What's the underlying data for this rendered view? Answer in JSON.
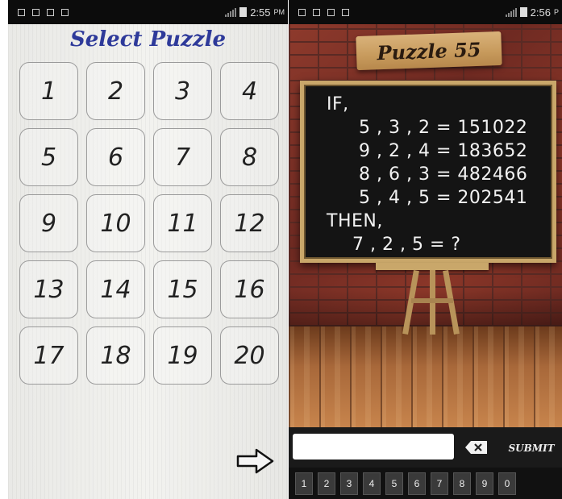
{
  "left_screen": {
    "status": {
      "time": "2:55",
      "ampm": "PM"
    },
    "title": "Select Puzzle",
    "puzzles": [
      "1",
      "2",
      "3",
      "4",
      "5",
      "6",
      "7",
      "8",
      "9",
      "10",
      "11",
      "12",
      "13",
      "14",
      "15",
      "16",
      "17",
      "18",
      "19",
      "20"
    ],
    "next_icon": "arrow-right-icon"
  },
  "right_screen": {
    "status": {
      "time": "2:56",
      "ampm": "P"
    },
    "puzzle_title": "Puzzle 55",
    "board_lines": [
      "IF,",
      "5 , 3 , 2 = 151022",
      "9 , 2 , 4 = 183652",
      "8 , 6 , 3 = 482466",
      "5 , 4 , 5 = 202541",
      "THEN,",
      "7 , 2 , 5 = ?"
    ],
    "answer_value": "",
    "backspace_icon": "backspace-icon",
    "submit_label": "SUBMIT",
    "keys": [
      "1",
      "2",
      "3",
      "4",
      "5",
      "6",
      "7",
      "8",
      "9",
      "0"
    ]
  }
}
